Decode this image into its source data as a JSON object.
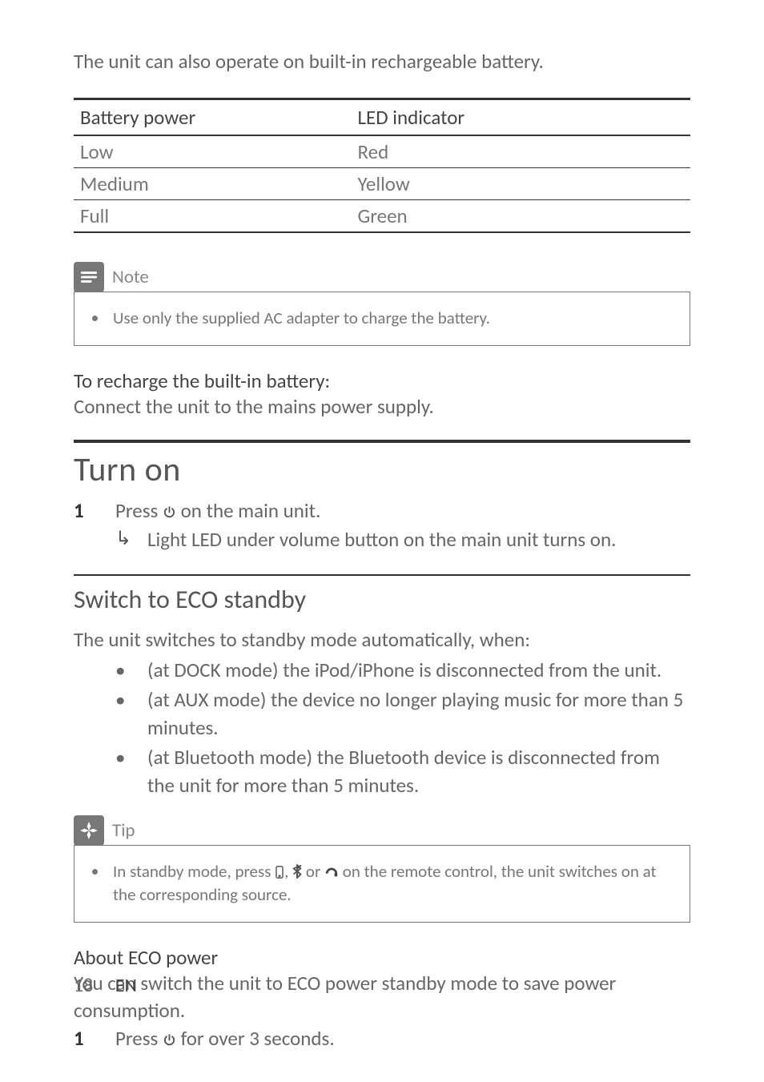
{
  "intro": "The unit can also operate on built-in rechargeable battery.",
  "battery_table": {
    "headers": [
      "Battery power",
      "LED indicator"
    ],
    "rows": [
      [
        "Low",
        "Red"
      ],
      [
        "Medium",
        "Yellow"
      ],
      [
        "Full",
        "Green"
      ]
    ]
  },
  "note": {
    "label": "Note",
    "items": [
      "Use only the supplied AC adapter to charge the battery."
    ]
  },
  "recharge": {
    "heading": "To recharge the built-in battery:",
    "text": "Connect the unit to the mains power supply."
  },
  "turn_on": {
    "heading": "Turn on",
    "step_num": "1",
    "step_pre": "Press ",
    "step_post": " on the main unit.",
    "substep": "Light LED under volume button on the main unit turns on."
  },
  "eco_standby": {
    "heading": "Switch to ECO standby",
    "intro": "The unit switches to standby mode automatically, when:",
    "bullets": [
      "(at DOCK mode) the iPod/iPhone is disconnected from the unit.",
      "(at AUX mode) the device no longer playing music for more than 5 minutes.",
      "(at Bluetooth mode) the Bluetooth device is disconnected from the unit for more than 5 minutes."
    ]
  },
  "tip": {
    "label": "Tip",
    "pre": "In standby mode, press ",
    "mid1": ", ",
    "mid2": " or ",
    "post": " on the remote control, the unit switches on at the corresponding source."
  },
  "about_eco": {
    "heading": "About ECO power",
    "text": "You can switch the unit to ECO power standby mode to save power consumption.",
    "step_num": "1",
    "step_pre": "Press ",
    "step_post": " for over 3 seconds."
  },
  "footer": {
    "page": "18",
    "lang": "EN"
  }
}
